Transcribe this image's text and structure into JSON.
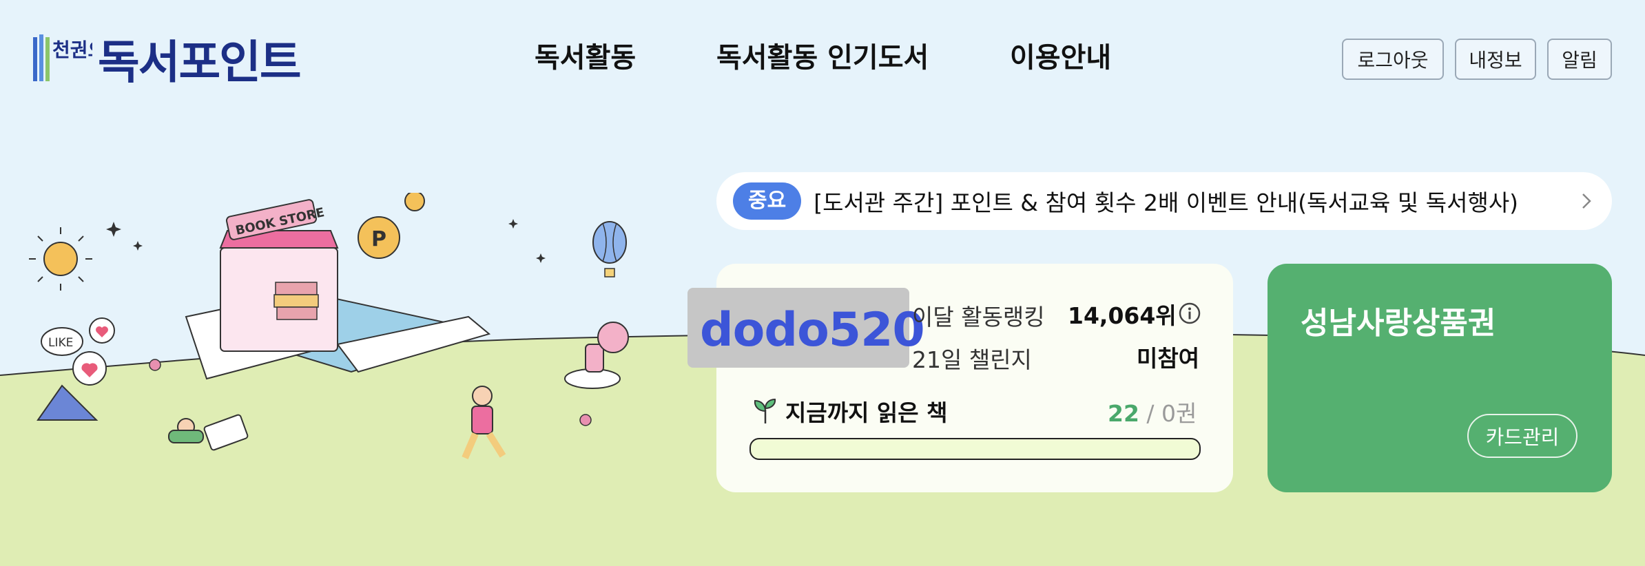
{
  "header": {
    "logo_text": "독서포인트",
    "logo_badge": "천권으로",
    "nav": [
      {
        "label": "독서활동"
      },
      {
        "label": "독서활동 인기도서"
      },
      {
        "label": "이용안내"
      }
    ],
    "buttons": {
      "logout": "로그아웃",
      "myinfo": "내정보",
      "alarm": "알림"
    }
  },
  "notice": {
    "badge": "중요",
    "text": "[도서관 주간] 포인트 & 참여 횟수 2배 이벤트 안내(독서교육 및 독서행사)",
    "icon": "chevron-right-icon"
  },
  "activity": {
    "user_id": "dodo520",
    "rank_label": "이달 활동랭킹",
    "rank_value": "14,064위",
    "challenge_label": "21일 챌린지",
    "challenge_value": "미참여",
    "books_label": "지금까지 읽은 책",
    "books_read": "22",
    "books_rest": " / 0권",
    "progress_fraction": 0
  },
  "voucher": {
    "title": "성남사랑상품권",
    "button": "카드관리"
  },
  "illustration": {
    "book_store_sign": "BOOK STORE",
    "like_bubble": "LIKE",
    "coin_letter": "P"
  },
  "colors": {
    "background": "#e6f3fb",
    "ground": "#dfedb4",
    "brand": "#1c2f86",
    "badge": "#4d7fe6",
    "voucher": "#55b070",
    "accent_green": "#4aa86b",
    "user_id": "#3c55d8"
  }
}
